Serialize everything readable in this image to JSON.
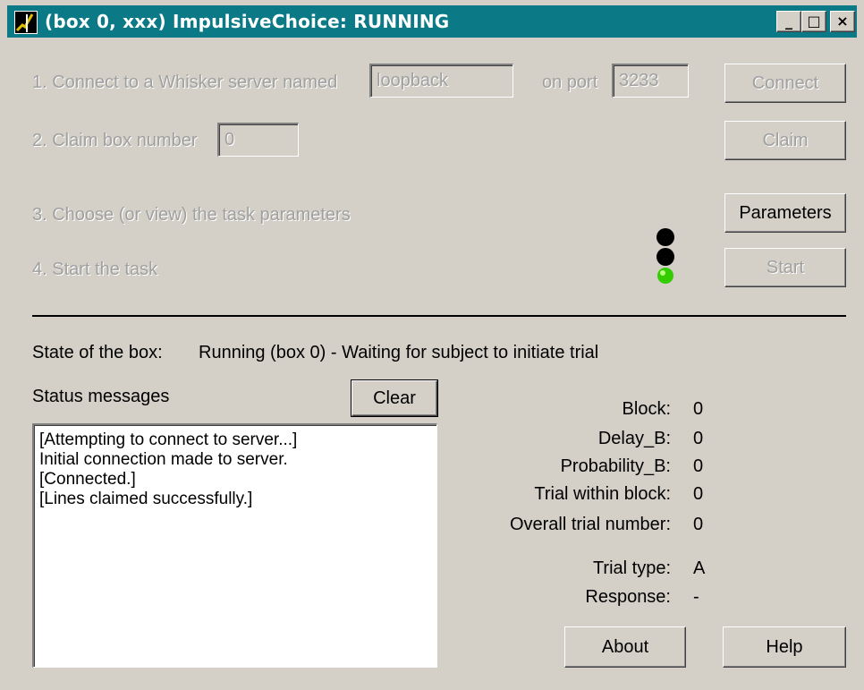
{
  "window": {
    "title": "(box 0, xxx) ImpulsiveChoice: RUNNING",
    "minimize_label": "_",
    "maximize_label": "□",
    "close_label": "×"
  },
  "setup": {
    "step1_label": "1. Connect to a Whisker server named",
    "server_name": "loopback",
    "port_label": "on port",
    "port": "3233",
    "connect_button": "Connect",
    "step2_label": "2. Claim box number",
    "box_number": "0",
    "claim_button": "Claim",
    "step3_label": "3. Choose (or view) the task parameters",
    "parameters_button": "Parameters",
    "step4_label": "4. Start the task",
    "start_button": "Start",
    "traffic_light": {
      "top": "#000000",
      "middle": "#000000",
      "bottom": "#33cc00"
    }
  },
  "state": {
    "label": "State of the box:",
    "value": "Running (box 0) - Waiting for subject to initiate trial"
  },
  "status": {
    "label": "Status messages",
    "clear_button": "Clear",
    "messages": [
      "[Attempting to connect to server...]",
      "Initial connection made to server.",
      "[Connected.]",
      "[Lines claimed successfully.]"
    ]
  },
  "stats": [
    {
      "label": "Block:",
      "value": "0"
    },
    {
      "label": "Delay_B:",
      "value": "0"
    },
    {
      "label": "Probability_B:",
      "value": "0"
    },
    {
      "label": "Trial within block:",
      "value": "0"
    },
    {
      "label": "Overall trial number:",
      "value": "0"
    },
    {
      "label": "Trial type:",
      "value": "A"
    },
    {
      "label": "Response:",
      "value": "-"
    }
  ],
  "footer": {
    "about_button": "About",
    "help_button": "Help"
  }
}
